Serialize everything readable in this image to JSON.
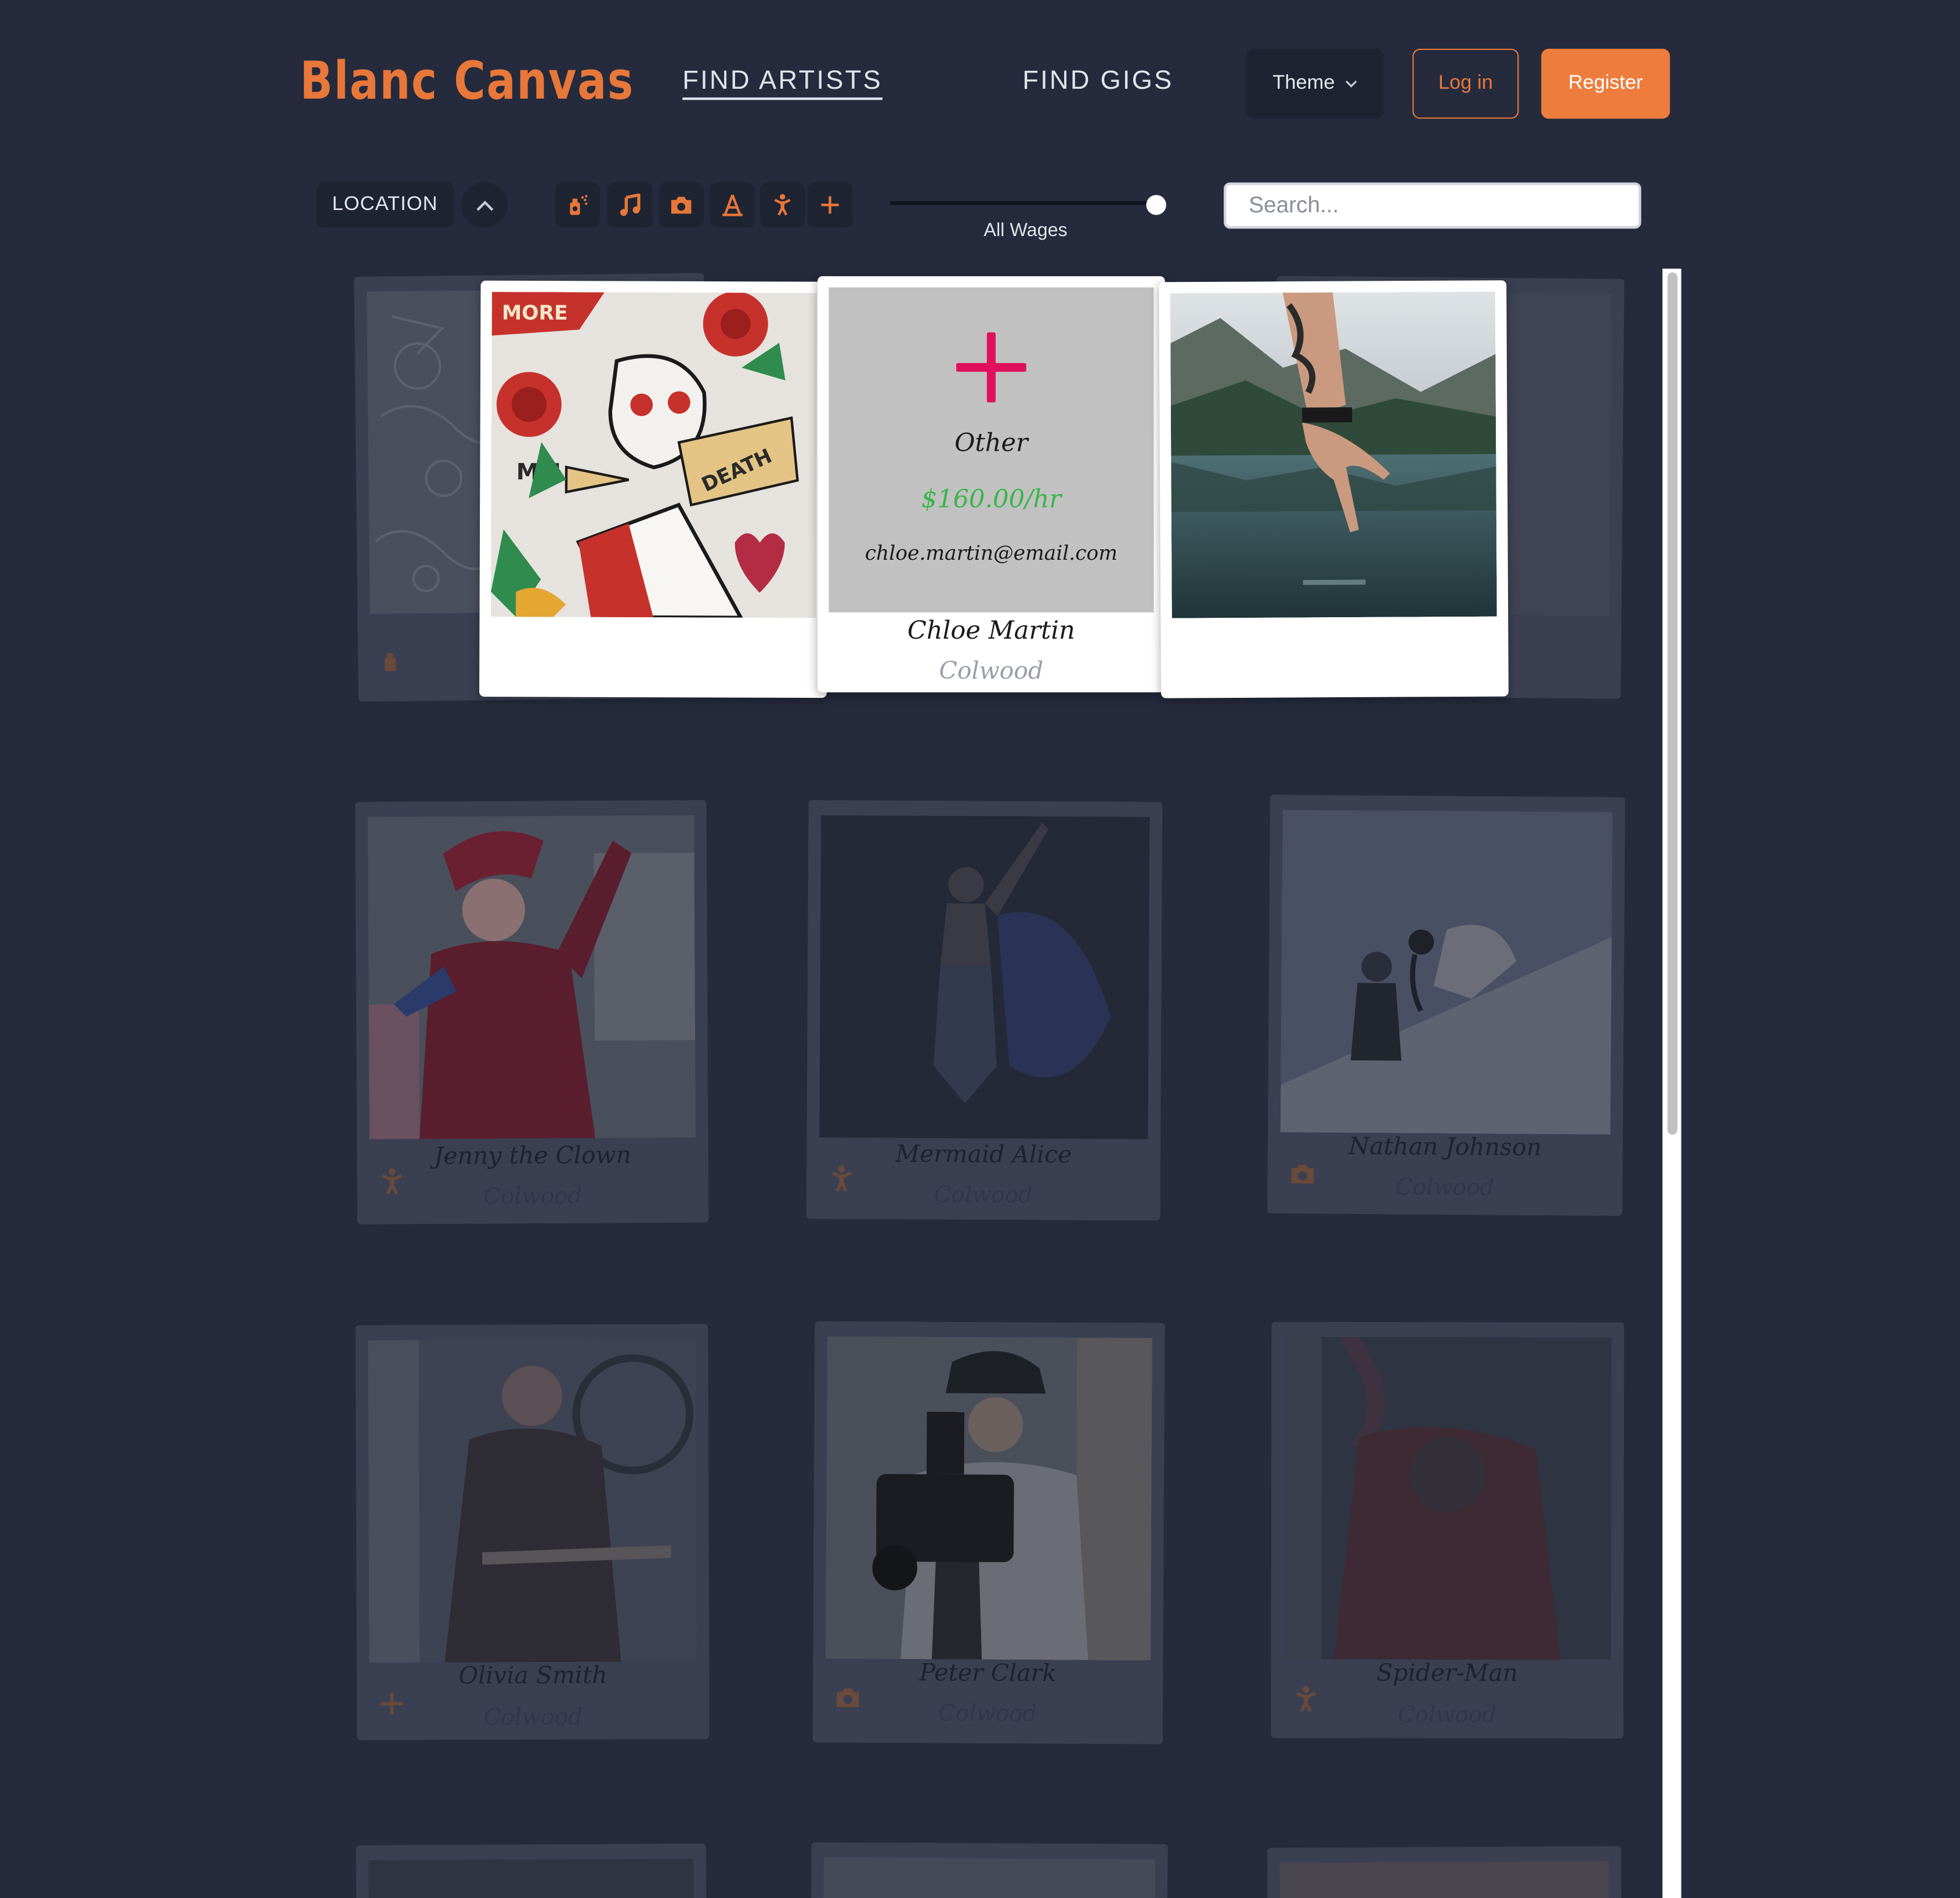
{
  "header": {
    "logo": "Blanc Canvas",
    "nav": [
      {
        "label": "FIND ARTISTS",
        "active": true
      },
      {
        "label": "FIND GIGS",
        "active": false
      }
    ],
    "theme_label": "Theme",
    "login_label": "Log in",
    "register_label": "Register"
  },
  "filters": {
    "location_label": "LOCATION",
    "category_icons": [
      "spray-paint-icon",
      "music-note-icon",
      "camera-icon",
      "easel-icon",
      "dancer-icon",
      "plus-icon"
    ],
    "wage_label": "All Wages",
    "wage_level": 1.0,
    "search_placeholder": "Search..."
  },
  "featured": {
    "category": "Other",
    "wage": "$160.00/hr",
    "email": "chloe.martin@email.com",
    "name": "Chloe Martin",
    "location": "Colwood"
  },
  "artists": [
    {
      "name": "Jenny the Clown",
      "location": "Colwood",
      "icon": "dancer-icon"
    },
    {
      "name": "Mermaid Alice",
      "location": "Colwood",
      "icon": "dancer-icon"
    },
    {
      "name": "Nathan Johnson",
      "location": "Colwood",
      "icon": "camera-icon"
    },
    {
      "name": "Olivia Smith",
      "location": "Colwood",
      "icon": "plus-icon"
    },
    {
      "name": "Peter Clark",
      "location": "Colwood",
      "icon": "camera-icon"
    },
    {
      "name": "Spider-Man",
      "location": "Colwood",
      "icon": "dancer-icon"
    }
  ],
  "colors": {
    "brand": "#e8773a",
    "background": "#252b3d",
    "wage": "#3ab54a",
    "accent_plus": "#e0105c"
  }
}
